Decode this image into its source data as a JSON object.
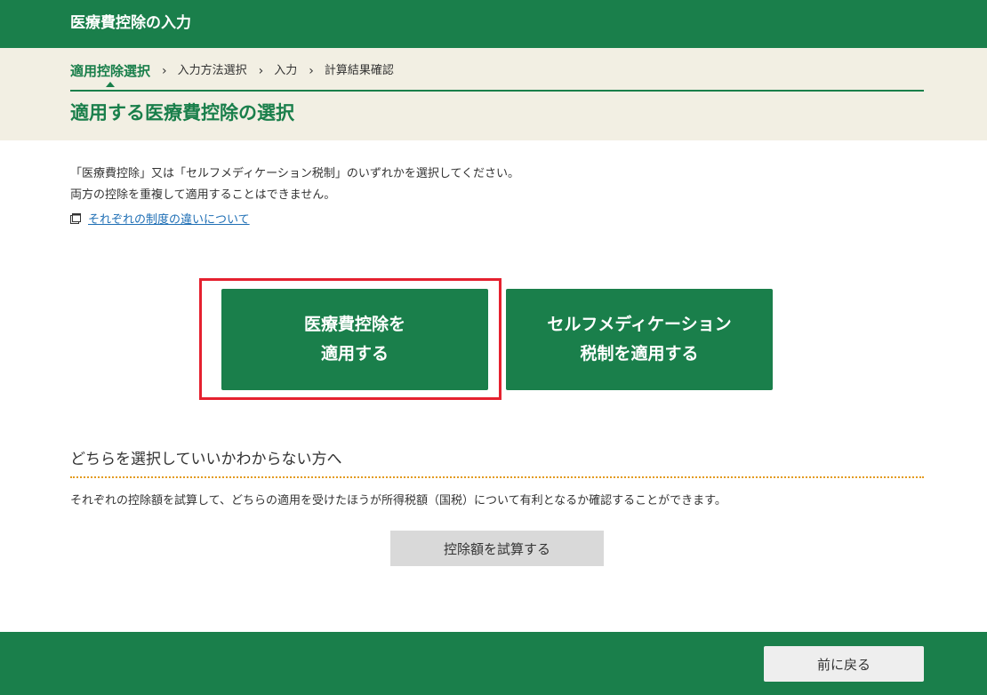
{
  "header": {
    "title": "医療費控除の入力"
  },
  "steps": {
    "items": [
      {
        "label": "適用控除選択",
        "active": true
      },
      {
        "label": "入力方法選択",
        "active": false
      },
      {
        "label": "入力",
        "active": false
      },
      {
        "label": "計算結果確認",
        "active": false
      }
    ],
    "separator": "›"
  },
  "page_title": "適用する医療費控除の選択",
  "intro": {
    "line1": "「医療費控除」又は「セルフメディケーション税制」のいずれかを選択してください。",
    "line2": "両方の控除を重複して適用することはできません。",
    "link_icon": "new-window-icon",
    "link_label": "それぞれの制度の違いについて"
  },
  "choices": {
    "medical": {
      "line1": "医療費控除を",
      "line2": "適用する"
    },
    "self_medication": {
      "line1": "セルフメディケーション",
      "line2": "税制を適用する"
    }
  },
  "help": {
    "heading": "どちらを選択していいかわからない方へ",
    "text": "それぞれの控除額を試算して、どちらの適用を受けたほうが所得税額（国税）について有利となるか確認することができます。",
    "calc_button": "控除額を試算する"
  },
  "footer": {
    "back_button": "前に戻る"
  },
  "colors": {
    "brand_green": "#1a7f4b",
    "band_beige": "#f2efe3",
    "highlight_red": "#e5212f",
    "divider_orange": "#e39b1f",
    "link_blue": "#1f6fb5"
  }
}
